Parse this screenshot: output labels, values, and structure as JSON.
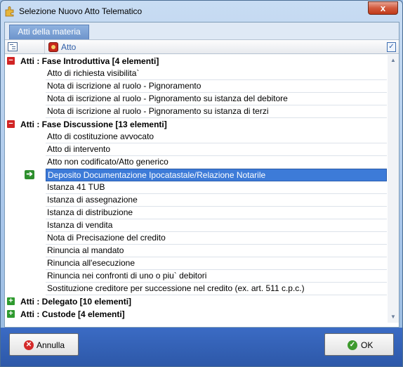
{
  "window": {
    "title": "Selezione Nuovo Atto Telematico",
    "close_label": "x"
  },
  "tab": {
    "label": "Atti della materia"
  },
  "header": {
    "column_label": "Atto"
  },
  "groups": [
    {
      "label": "Atti : Fase Introduttiva  [4 elementi]",
      "expanded": true,
      "items": [
        "Atto di richiesta visibilita`",
        "Nota di iscrizione al ruolo - Pignoramento",
        "Nota di iscrizione al ruolo - Pignoramento su istanza del debitore",
        "Nota di iscrizione al ruolo - Pignoramento su istanza di terzi"
      ]
    },
    {
      "label": "Atti : Fase Discussione  [13 elementi]",
      "expanded": true,
      "items": [
        "Atto di costituzione avvocato",
        "Atto di intervento",
        "Atto non codificato/Atto generico",
        "Deposito Documentazione Ipocatastale/Relazione Notarile",
        "Istanza 41 TUB",
        "Istanza di assegnazione",
        "Istanza di distribuzione",
        "Istanza di vendita",
        "Nota di Precisazione del credito",
        "Rinuncia al mandato",
        "Rinuncia all'esecuzione",
        "Rinuncia nei confronti di uno o piu` debitori",
        "Sostituzione creditore per successione nel credito (ex. art. 511 c.p.c.)"
      ]
    },
    {
      "label": "Atti : Delegato  [10 elementi]",
      "expanded": false,
      "items": []
    },
    {
      "label": "Atti : Custode  [4 elementi]",
      "expanded": false,
      "items": []
    }
  ],
  "selected_item": "Deposito Documentazione Ipocatastale/Relazione Notarile",
  "buttons": {
    "cancel_label": "Annulla",
    "ok_label": "OK"
  },
  "colors": {
    "selection": "#3d7bd8",
    "footer": "#2d58a8",
    "tab": "#7ea4d8"
  }
}
